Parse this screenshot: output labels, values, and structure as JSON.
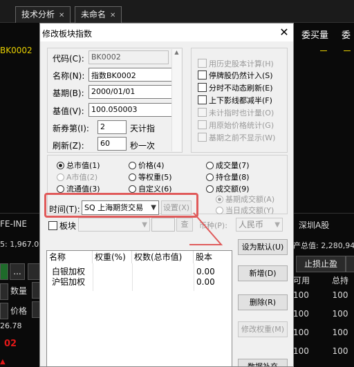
{
  "background": {
    "tabs": [
      {
        "label": "技术分析"
      },
      {
        "label": "未命名"
      }
    ],
    "block_code": "BK0002",
    "top_right": [
      "委买量",
      "委"
    ],
    "futures_label": "FE-INE",
    "market_label": "深圳A股",
    "assets_left": "5: 1,967.0",
    "assets_right": "产总值: 2,280,94",
    "stop_button": "止损止盈",
    "col_available": "可用",
    "col_total": "总持",
    "row_value": "100",
    "qty_label": "数量",
    "price_label": "价格",
    "price_value": "26.78",
    "red_value": "02",
    "ellipsis_button": "..."
  },
  "dialog": {
    "title": "修改板块指数",
    "fields": {
      "code_label": "代码(C):",
      "code_value": "BK0002",
      "name_label": "名称(N):",
      "name_value": "指数BK0002",
      "base_date_label": "基期(B):",
      "base_date_value": "2000/01/01",
      "base_value_label": "基值(V):",
      "base_value_value": "100.050003",
      "new_stock_label": "新券第(I):",
      "new_stock_value": "2",
      "new_stock_unit": "天计指",
      "refresh_label": "刷新(Z):",
      "refresh_value": "60",
      "refresh_unit": "秒一次"
    },
    "options": [
      {
        "label": "用历史股本计算(H)",
        "checked": false,
        "disabled": true
      },
      {
        "label": "停牌股仍然计入(S)",
        "checked": false,
        "disabled": false
      },
      {
        "label": "分时不动态刷新(E)",
        "checked": false,
        "disabled": false
      },
      {
        "label": "上下影线都减半(F)",
        "checked": false,
        "disabled": false
      },
      {
        "label": "未计指时也计量(O)",
        "checked": false,
        "disabled": true
      },
      {
        "label": "用原始价格统计(G)",
        "checked": false,
        "disabled": true
      },
      {
        "label": "基期之前不显示(W)",
        "checked": false,
        "disabled": true
      }
    ],
    "weights": {
      "col1": [
        {
          "label": "总市值(1)",
          "selected": true,
          "disabled": false
        },
        {
          "label": "A市值(2)",
          "selected": false,
          "disabled": true
        },
        {
          "label": "流通值(3)",
          "selected": false,
          "disabled": false
        }
      ],
      "col2": [
        {
          "label": "价格(4)",
          "selected": false,
          "disabled": false
        },
        {
          "label": "等权重(5)",
          "selected": false,
          "disabled": false
        },
        {
          "label": "自定义(6)",
          "selected": false,
          "disabled": false
        }
      ],
      "col3": [
        {
          "label": "成交量(7)",
          "selected": false,
          "disabled": false
        },
        {
          "label": "持仓量(8)",
          "selected": false,
          "disabled": false
        },
        {
          "label": "成交额(9)",
          "selected": false,
          "disabled": false
        }
      ],
      "sub": [
        {
          "label": "基期成交额(A)",
          "selected": true,
          "disabled": true
        },
        {
          "label": "当日成交额(Y)",
          "selected": false,
          "disabled": true
        }
      ]
    },
    "time_label": "时间(T):",
    "time_value": "SQ 上海期货交易",
    "settings_button": "设置(X)",
    "block_label": "板块",
    "view_button": "查",
    "currency_label": "币种(P):",
    "currency_value": "人民币",
    "table": {
      "headers": [
        "名称",
        "权重(%)",
        "权数(总市值)",
        "股本"
      ],
      "rows": [
        {
          "name": "白银加权",
          "weight": "",
          "count": "",
          "capital": "0.00"
        },
        {
          "name": "沪铝加权",
          "weight": "",
          "count": "",
          "capital": "0.00"
        }
      ]
    },
    "buttons": {
      "set_default": "设为默认(U)",
      "add": "新增(D)",
      "delete": "删除(R)",
      "modify_weight": "修改权重(M)",
      "data_fill": "数据补充"
    }
  }
}
